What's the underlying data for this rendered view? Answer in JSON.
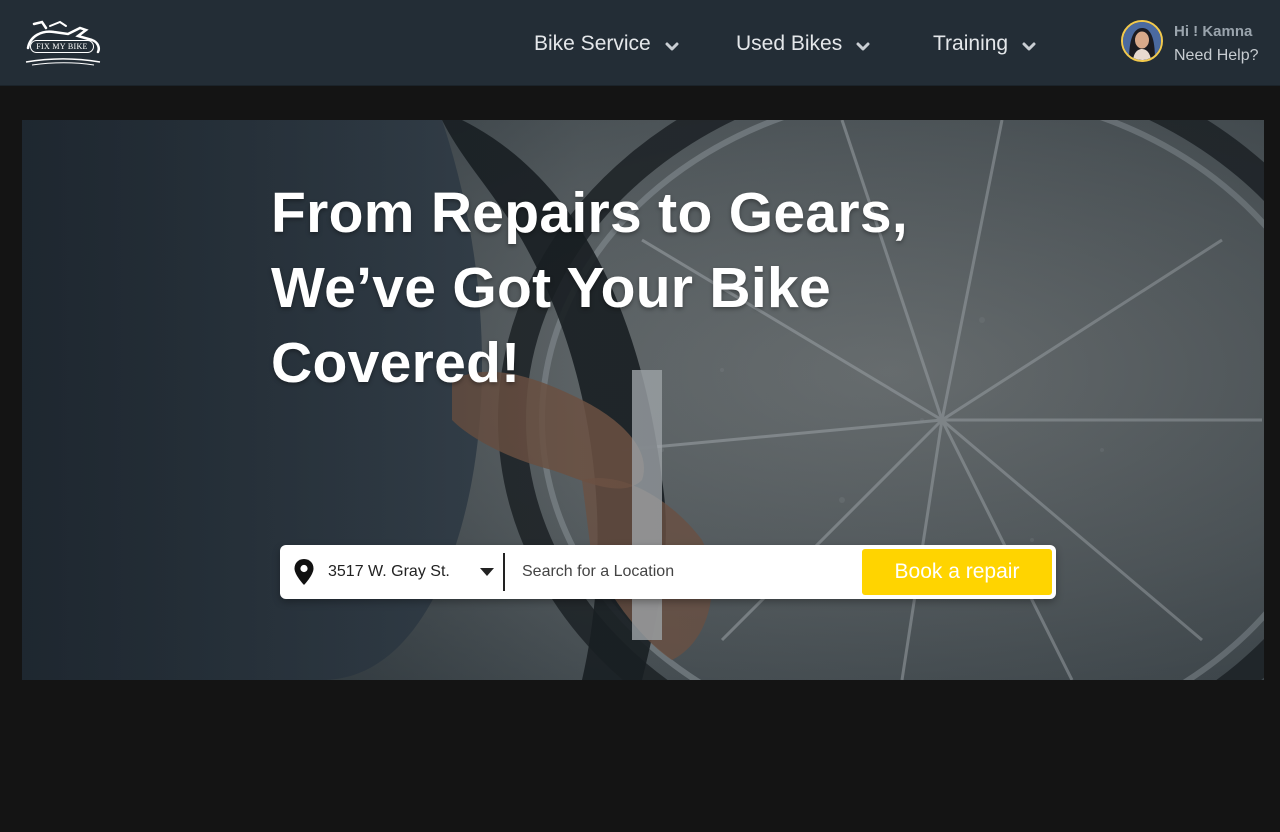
{
  "header": {
    "logo_text": "FIX MY BIKE",
    "nav": [
      {
        "label": "Bike Service",
        "icon": "chevron-down-icon"
      },
      {
        "label": "Used Bikes",
        "icon": "chevron-down-icon"
      },
      {
        "label": "Training",
        "icon": "chevron-down-icon"
      }
    ],
    "user": {
      "greeting": "Hi ! Kamna",
      "help": "Need Help?"
    }
  },
  "hero": {
    "title_lines": [
      "From Repairs to Gears,",
      "We’ve Got Your Bike",
      "Covered!"
    ]
  },
  "search": {
    "selected_city": "3517 W. Gray St.",
    "location_placeholder": "Search for a Location",
    "book_label": "Book a repair"
  },
  "colors": {
    "accent": "#ffd400",
    "header_bg": "#232d36",
    "page_bg": "#141414"
  }
}
